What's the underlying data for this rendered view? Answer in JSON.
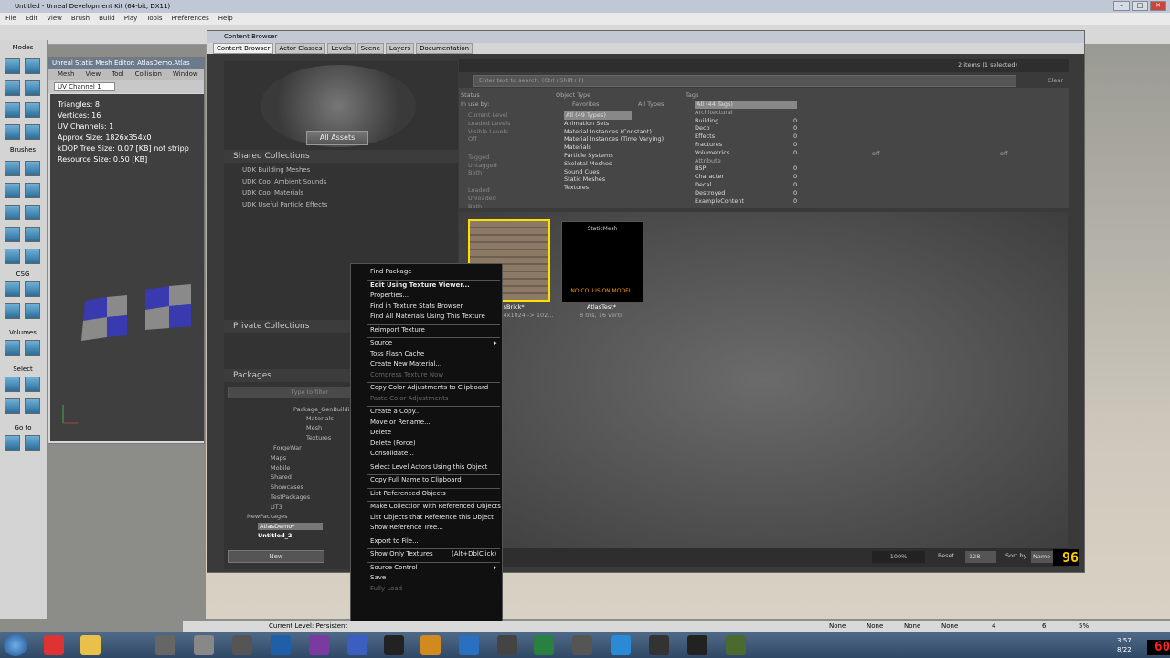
{
  "window": {
    "title": "Untitled - Unreal Development Kit (64-bit, DX11)"
  },
  "menubar": [
    "File",
    "Edit",
    "View",
    "Brush",
    "Build",
    "Play",
    "Tools",
    "Preferences",
    "Help"
  ],
  "left_panel": {
    "modes": "Modes",
    "brushes": "Brushes",
    "csg": "CSG",
    "volumes": "Volumes",
    "select": "Select",
    "goto": "Go to"
  },
  "mesh_editor": {
    "title": "Unreal Static Mesh Editor: AtlasDemo.Atlas",
    "menu": [
      "Mesh",
      "View",
      "Tool",
      "Collision",
      "Window"
    ],
    "uv_channel": "UV Channel 1",
    "stats": [
      "Triangles:  8",
      "Vertices:  16",
      "UV Channels:  1",
      "Approx Size:  1826x354x0",
      "kDOP Tree Size:  0.07 [KB] not stripp",
      "Resource Size:  0.50 [KB]"
    ]
  },
  "content_browser": {
    "title": "Content Browser",
    "tabs": [
      "Content Browser",
      "Actor Classes",
      "Levels",
      "Scene",
      "Layers",
      "Documentation"
    ],
    "items_count": "2 items (1 selected)",
    "search_placeholder": "Enter text to search. (Ctrl+Shift+F)",
    "clear_label": "Clear",
    "all_assets": "All Assets",
    "shared_collections": "Shared Collections",
    "shared_items": [
      "UDK Building Meshes",
      "UDK Cool Ambient Sounds",
      "UDK Cool Materials",
      "UDK Useful Particle Effects"
    ],
    "private_collections": "Private Collections",
    "packages": "Packages",
    "filter_placeholder": "Type to filter",
    "package_tree": [
      "Package_GenBuilding",
      "Materials",
      "Mesh",
      "Textures",
      "ForgeWar",
      "Maps",
      "Mobile",
      "Shared",
      "Showcases",
      "TestPackages",
      "UT3",
      "NewPackages",
      "AtlasDemo*",
      "Untitled_2"
    ],
    "new_button": "New",
    "filters": {
      "status_h": "Status",
      "in_use_by": "In use by:",
      "status_items": [
        "Current Level",
        "Loaded Levels",
        "Visible Levels",
        "Off",
        "Tagged",
        "Untagged",
        "Both",
        "Loaded",
        "Unloaded",
        "Both"
      ],
      "object_type_h": "Object Type",
      "favorites": "Favorites",
      "all_types": "All Types",
      "types": [
        "All (49 Types)",
        "Animation Sets",
        "Material Instances (Constant)",
        "Material Instances (Time Varying)",
        "Materials",
        "Particle Systems",
        "Skeletal Meshes",
        "Sound Cues",
        "Static Meshes",
        "Textures"
      ],
      "tags_h": "Tags",
      "tags": [
        "All (44 Tags)",
        "Architectural",
        "Building",
        "Deco",
        "Effects",
        "Fractures",
        "Volumetrics",
        "Attribute",
        "BSP",
        "Character",
        "Decal",
        "Destroyed",
        "ExampleContent"
      ],
      "tag_counts": [
        "",
        "",
        "0",
        "0",
        "0",
        "0",
        "0",
        "",
        "0",
        "0",
        "0",
        "0",
        "0"
      ],
      "off1": "off",
      "off2": "off"
    },
    "assets": [
      {
        "name": "AtlasBrick*",
        "info": "1024x1024 -> 102..."
      },
      {
        "name": "AtlasTest*",
        "badge": "StaticMesh",
        "warning": "NO COLLISION MODEL!",
        "info": "8 tris, 16 verts"
      }
    ],
    "zoom": "100%",
    "reset": "Reset",
    "thumb_size": "128",
    "sort_by": "Sort by",
    "sort_value": "Name",
    "count_display": "96"
  },
  "context_menu": [
    {
      "label": "Find Package",
      "style": ""
    },
    {
      "sep": true
    },
    {
      "label": "Edit Using Texture Viewer...",
      "style": "bold"
    },
    {
      "label": "Properties...",
      "style": ""
    },
    {
      "label": "Find in Texture Stats Browser",
      "style": ""
    },
    {
      "label": "Find All Materials Using This Texture",
      "style": ""
    },
    {
      "sep": true
    },
    {
      "label": "Reimport Texture",
      "style": ""
    },
    {
      "sep": true
    },
    {
      "label": "Source",
      "style": "",
      "sub": true
    },
    {
      "label": "Toss Flash Cache",
      "style": ""
    },
    {
      "label": "Create New Material...",
      "style": ""
    },
    {
      "label": "Compress Texture Now",
      "style": "dis"
    },
    {
      "sep": true
    },
    {
      "label": "Copy Color Adjustments to Clipboard",
      "style": ""
    },
    {
      "label": "Paste Color Adjustments",
      "style": "dis"
    },
    {
      "sep": true
    },
    {
      "label": "Create a Copy...",
      "style": ""
    },
    {
      "label": "Move or Rename...",
      "style": ""
    },
    {
      "label": "Delete",
      "style": ""
    },
    {
      "label": "Delete (Force)",
      "style": ""
    },
    {
      "label": "Consolidate...",
      "style": ""
    },
    {
      "sep": true
    },
    {
      "label": "Select Level Actors Using this Object",
      "style": ""
    },
    {
      "sep": true
    },
    {
      "label": "Copy Full Name to Clipboard",
      "style": ""
    },
    {
      "sep": true
    },
    {
      "label": "List Referenced Objects",
      "style": ""
    },
    {
      "sep": true
    },
    {
      "label": "Make Collection with Referenced Objects",
      "style": ""
    },
    {
      "label": "List Objects that Reference this Object",
      "style": ""
    },
    {
      "label": "Show Reference Tree...",
      "style": ""
    },
    {
      "sep": true
    },
    {
      "label": "Export to File...",
      "style": ""
    },
    {
      "sep": true
    },
    {
      "label": "Show Only Textures",
      "style": "",
      "shortcut": "(Alt+DblClick)"
    },
    {
      "sep": true
    },
    {
      "label": "Source Control",
      "style": "",
      "sub": true
    },
    {
      "label": "Save",
      "style": ""
    },
    {
      "label": "Fully Load",
      "style": "dis"
    }
  ],
  "statusbar": {
    "current_level": "Current Level:  Persistent",
    "none1": "None",
    "none2": "None",
    "none3": "None",
    "none4": "None",
    "val1": "4",
    "val2": "6",
    "pct": "5%"
  },
  "taskbar": {
    "time": "3:57",
    "date": "8/22"
  },
  "fps": "60"
}
